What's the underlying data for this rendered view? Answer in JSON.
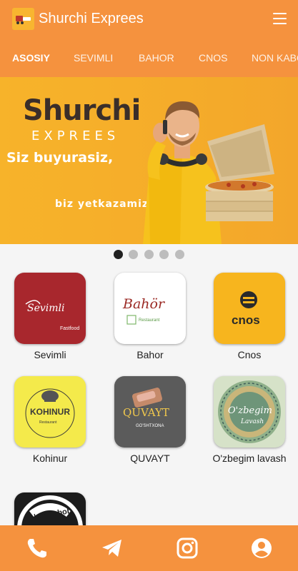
{
  "appbar": {
    "title": "Shurchi Exprees",
    "logo_text": "Shurchi Exprees",
    "logo_icon": "delivery-truck-icon",
    "menu_icon": "hamburger-menu-icon"
  },
  "tabs": [
    {
      "label": "ASOSIY",
      "active": true
    },
    {
      "label": "SEVIMLI",
      "active": false
    },
    {
      "label": "BAHOR",
      "active": false
    },
    {
      "label": "CNOS",
      "active": false
    },
    {
      "label": "NON KABOB",
      "active": false
    }
  ],
  "banner": {
    "brand": "Shurchi",
    "brand_sub": "EXPREES",
    "line1": "Siz buyurasiz,",
    "line2": "biz yetkazamiz !"
  },
  "carousel": {
    "total": 5,
    "active_index": 0
  },
  "restaurants": [
    {
      "name": "Sevimli",
      "logo_text": "Sevimli",
      "logo_sub": "Fastfood",
      "bg": "#a8272d"
    },
    {
      "name": "Bahor",
      "logo_text": "Bahör",
      "logo_sub": "Restaurant",
      "bg": "#ffffff"
    },
    {
      "name": "Cnos",
      "logo_text": "cnos",
      "bg": "#f7b51e"
    },
    {
      "name": "Kohinur",
      "logo_text": "KOHINUR",
      "logo_sub": "Restaurant",
      "bg": "#f4ea4b"
    },
    {
      "name": "QUVAYT",
      "logo_text": "QUVAYT",
      "logo_sub": "GO'SHTXONA",
      "bg": "#5b5b5b"
    },
    {
      "name": "O'zbegim lavash",
      "logo_text": "O'zbegim",
      "logo_sub": "Lavash",
      "bg": "#d6e2c8"
    },
    {
      "name": "",
      "logo_text": "Non Kabob",
      "bg": "#1c1c1c"
    }
  ],
  "bottom_nav": [
    {
      "icon": "phone-icon"
    },
    {
      "icon": "telegram-icon"
    },
    {
      "icon": "instagram-icon"
    },
    {
      "icon": "account-icon"
    }
  ],
  "colors": {
    "primary": "#f5923e",
    "banner": "#f7b32a",
    "active_dot": "#212121",
    "inactive_dot": "#bdbdbd"
  }
}
